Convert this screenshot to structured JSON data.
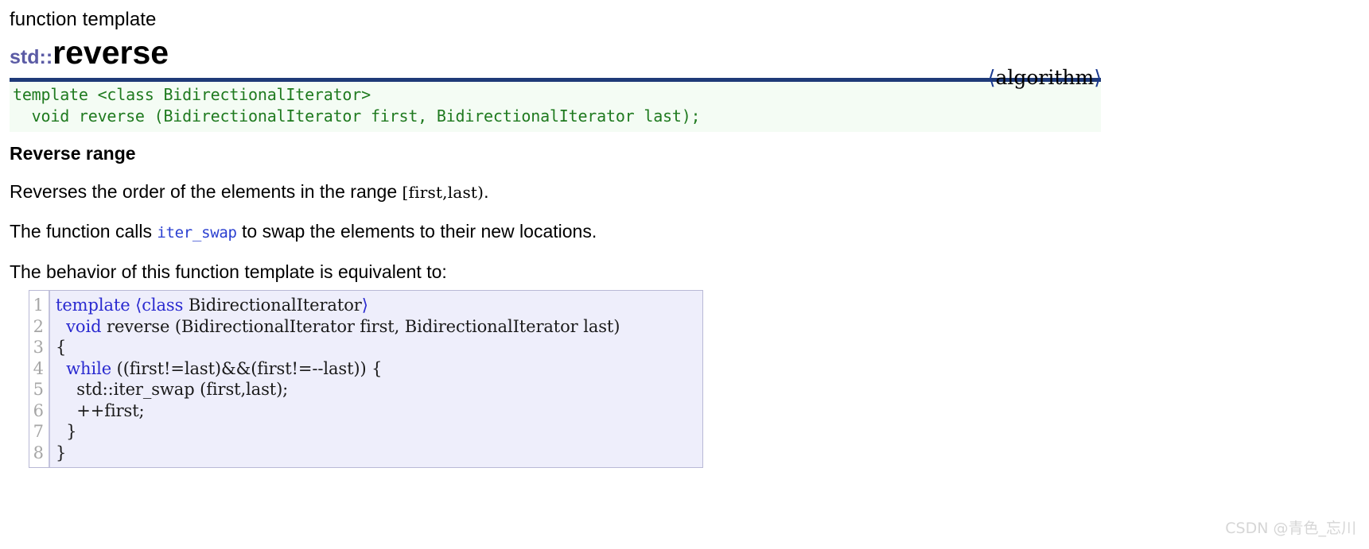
{
  "header": {
    "kind_label": "function template",
    "namespace": "std::",
    "name": "reverse",
    "include_open": "⟨",
    "include_name": "algorithm",
    "include_close": "⟩"
  },
  "signature": {
    "line1": "template <class BidirectionalIterator>",
    "line2": "  void reverse (BidirectionalIterator first, BidirectionalIterator last);",
    "text_color": "#1f7a1f",
    "background": "#f4fcf4",
    "border_color": "#1f3a78"
  },
  "content": {
    "section_title": "Reverse range",
    "para1_before": "Reverses the order of the elements in the range ",
    "para1_code": "[first,last)",
    "para1_after": ".",
    "para2_before": "The function calls ",
    "para2_link": "iter_swap",
    "para2_after": " to swap the elements to their new locations.",
    "para3": "The behavior of this function template is equivalent to:"
  },
  "code_block": {
    "line_numbers": [
      "1",
      "2",
      "3",
      "4",
      "5",
      "6",
      "7",
      "8"
    ],
    "lines": [
      {
        "segments": [
          {
            "text": "template",
            "style": "kw"
          },
          {
            "text": " ",
            "style": "plain"
          },
          {
            "text": "⟨",
            "style": "ang"
          },
          {
            "text": "class",
            "style": "kw"
          },
          {
            "text": " BidirectionalIterator",
            "style": "plain"
          },
          {
            "text": "⟩",
            "style": "ang"
          }
        ]
      },
      {
        "segments": [
          {
            "text": "  ",
            "style": "plain"
          },
          {
            "text": "void",
            "style": "kw"
          },
          {
            "text": " reverse (BidirectionalIterator first, BidirectionalIterator last)",
            "style": "plain"
          }
        ]
      },
      {
        "segments": [
          {
            "text": "{",
            "style": "plain"
          }
        ]
      },
      {
        "segments": [
          {
            "text": "  ",
            "style": "plain"
          },
          {
            "text": "while",
            "style": "kw"
          },
          {
            "text": " ((first!=last)&&(first!=--last)) {",
            "style": "plain"
          }
        ]
      },
      {
        "segments": [
          {
            "text": "    std::iter_swap (first,last);",
            "style": "plain"
          }
        ]
      },
      {
        "segments": [
          {
            "text": "    ++first;",
            "style": "plain"
          }
        ]
      },
      {
        "segments": [
          {
            "text": "  }",
            "style": "plain"
          }
        ]
      },
      {
        "segments": [
          {
            "text": "}",
            "style": "plain"
          }
        ]
      }
    ],
    "background": "#eeeefb",
    "keyword_color": "#2a2ad0",
    "gutter_color": "#a6a6a6"
  },
  "watermark": {
    "text": "CSDN @青色_忘川"
  }
}
